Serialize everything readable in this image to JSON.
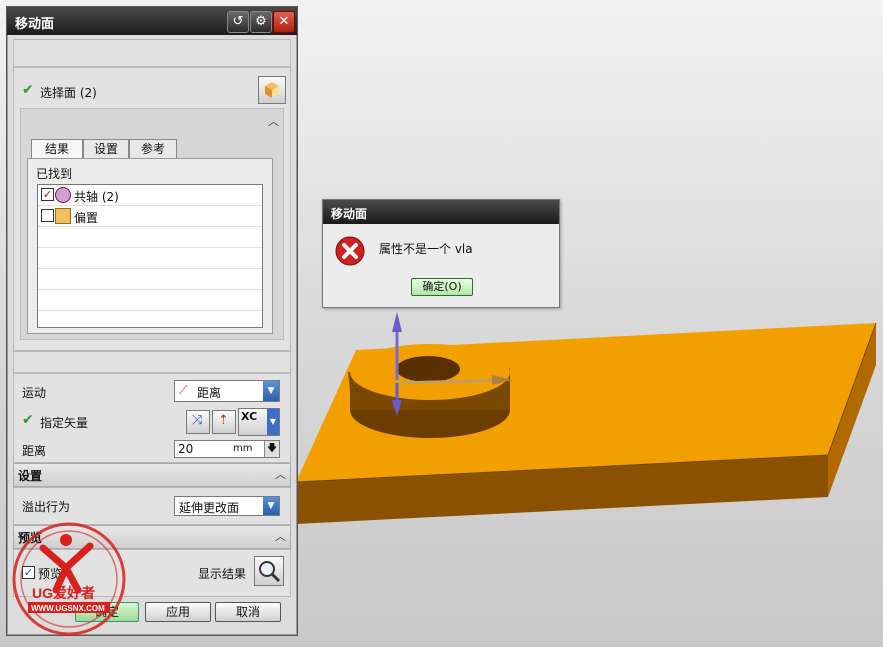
{
  "dialog": {
    "title": "移动面",
    "select_face_label": "选择面 (2)",
    "tabs": [
      "结果",
      "设置",
      "参考"
    ],
    "found_label": "已找到",
    "found_items": [
      {
        "label": "共轴 (2)",
        "checked": true
      },
      {
        "label": "偏置",
        "checked": false
      }
    ],
    "motion_label": "运动",
    "motion_value": "距离",
    "specify_vector_label": "指定矢量",
    "vector_xc_label": "XC",
    "distance_label": "距离",
    "distance_value": "20",
    "distance_unit": "mm",
    "settings_section": "设置",
    "overflow_label": "溢出行为",
    "overflow_value": "延伸更改面",
    "preview_section": "预览",
    "preview_checkbox_label": "预览",
    "preview_checked": true,
    "show_result_label": "显示结果",
    "ok_button": "确定",
    "apply_button": "应用",
    "cancel_button": "取消"
  },
  "error_dialog": {
    "title": "移动面",
    "message": "属性不是一个 vla",
    "ok_button": "确定(O)"
  },
  "watermark": {
    "text": "UG爱好者",
    "url": "WWW.UGSNX.COM"
  },
  "colors": {
    "part_orange": "#f2a000",
    "title_bar": "#2a2a2a",
    "error_red": "#d02020",
    "check_green": "#2a9a2a"
  }
}
